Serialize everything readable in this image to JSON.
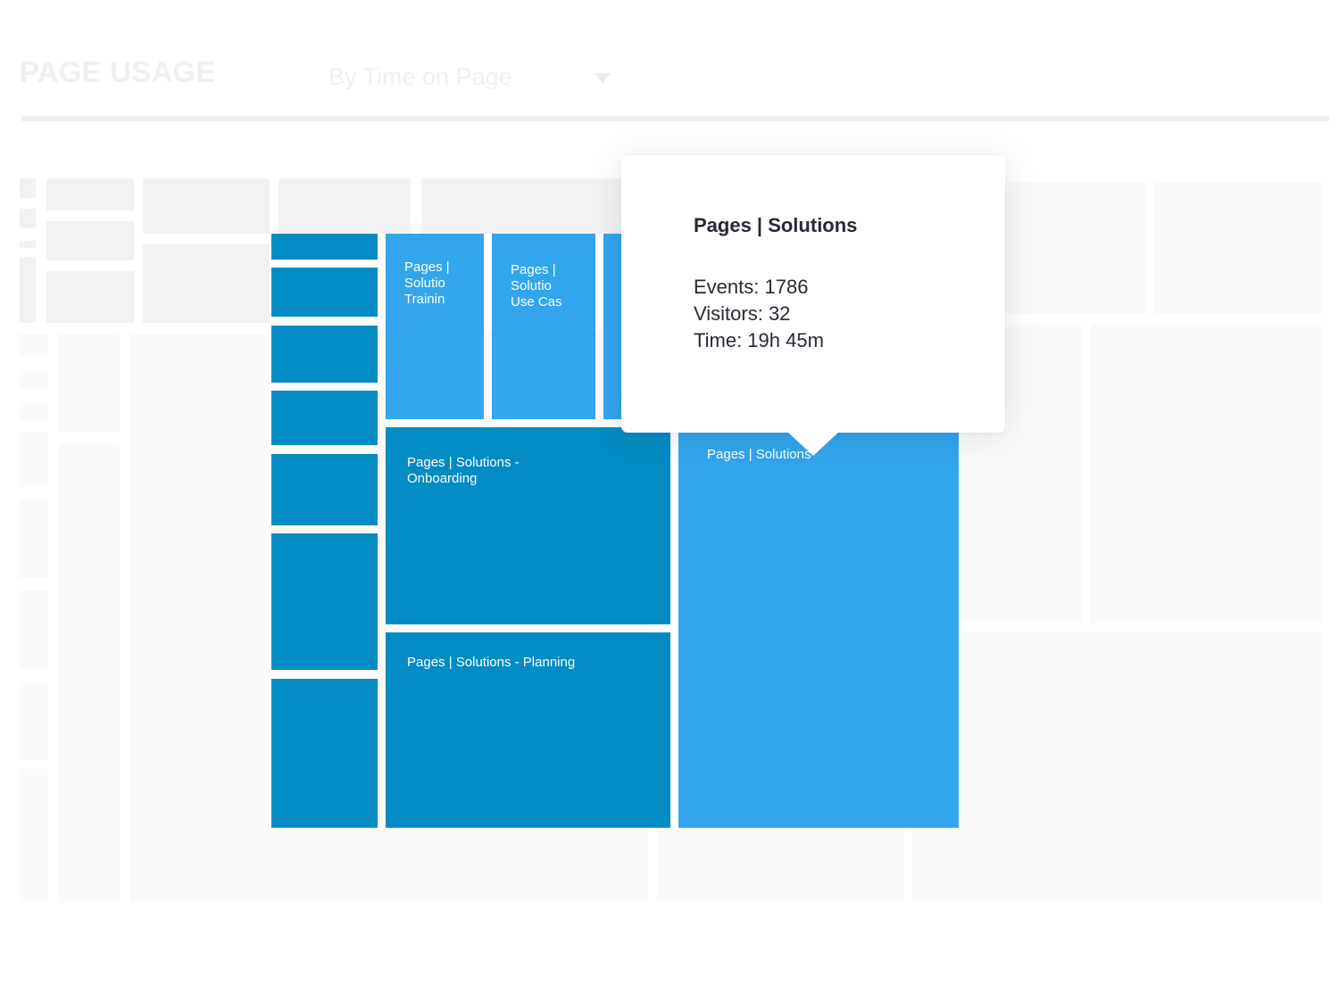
{
  "header": {
    "title": "PAGE USAGE",
    "sort_dropdown": {
      "selected": "By Time on Page",
      "icon": "caret-down-icon"
    }
  },
  "colors": {
    "tile_dark": "#038cc4",
    "tile_light": "#33a5ec",
    "ghost_dark": "#f2f2f4",
    "ghost_light": "#fafafa",
    "tooltip_text": "#262a36"
  },
  "chart_data": {
    "type": "treemap",
    "title": "PAGE USAGE",
    "metric": "By Time on Page",
    "tiles": [
      {
        "label": "Pages | Solutions",
        "display_label": "Pages | Solutions",
        "shade": "light",
        "events": 1786,
        "visitors": 32,
        "time": "19h 45m",
        "highlighted": true
      },
      {
        "label": "Pages | Solutions - Onboarding",
        "display_label": "Pages | Solutions -\nOnboarding",
        "shade": "dark"
      },
      {
        "label": "Pages | Solutions - Planning",
        "display_label": "Pages | Solutions - Planning",
        "shade": "dark"
      },
      {
        "label": "Pages | Solutions - Training",
        "display_label": "Pages |\nSolutio\nTrainin",
        "shade": "light"
      },
      {
        "label": "Pages | Solutions - Use Cases",
        "display_label": "Pages |\nSolutio\nUse Cas",
        "shade": "light"
      },
      {
        "label": "",
        "display_label": "",
        "shade": "light"
      },
      {
        "label": "",
        "display_label": "",
        "shade": "dark"
      },
      {
        "label": "",
        "display_label": "",
        "shade": "dark"
      },
      {
        "label": "",
        "display_label": "",
        "shade": "dark"
      },
      {
        "label": "",
        "display_label": "",
        "shade": "dark"
      },
      {
        "label": "",
        "display_label": "",
        "shade": "dark"
      },
      {
        "label": "",
        "display_label": "",
        "shade": "dark"
      },
      {
        "label": "",
        "display_label": "",
        "shade": "dark"
      }
    ]
  },
  "tooltip": {
    "title": "Pages | Solutions",
    "events": "Events: 1786",
    "visitors": "Visitors: 32",
    "time": "Time: 19h 45m"
  }
}
